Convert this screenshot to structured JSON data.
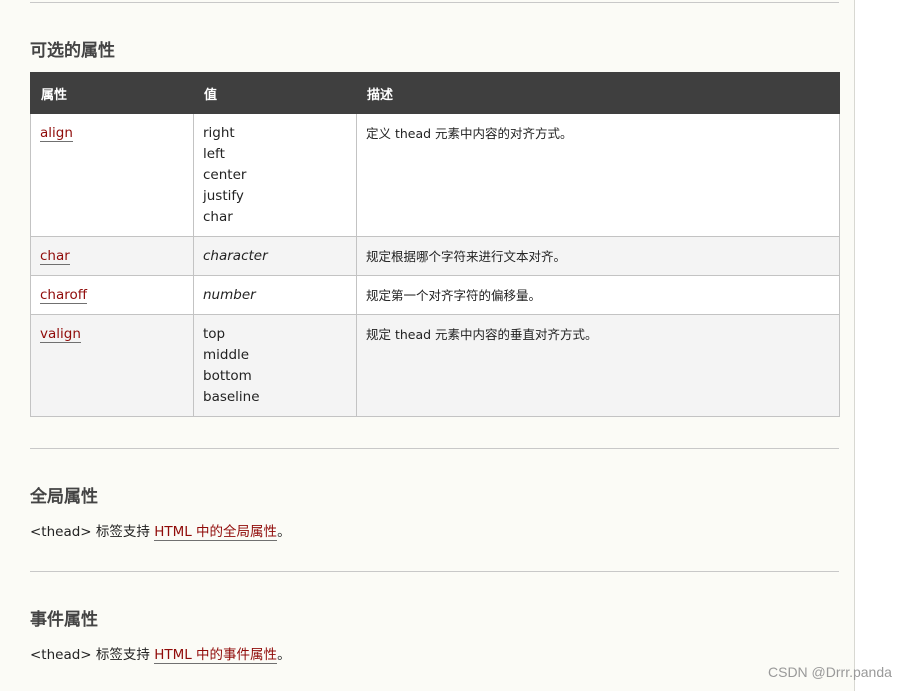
{
  "section_optional": {
    "title": "可选的属性",
    "headers": [
      "属性",
      "值",
      "描述"
    ],
    "rows": [
      {
        "attr": "align",
        "values": [
          "right",
          "left",
          "center",
          "justify",
          "char"
        ],
        "desc": "定义 thead 元素中内容的对齐方式。"
      },
      {
        "attr": "char",
        "values": [
          "character"
        ],
        "desc": "规定根据哪个字符来进行文本对齐。"
      },
      {
        "attr": "charoff",
        "values": [
          "number"
        ],
        "desc": "规定第一个对齐字符的偏移量。"
      },
      {
        "attr": "valign",
        "values": [
          "top",
          "middle",
          "bottom",
          "baseline"
        ],
        "desc": "规定 thead 元素中内容的垂直对齐方式。"
      }
    ]
  },
  "section_global": {
    "title": "全局属性",
    "text_prefix": "<thead> 标签支持 ",
    "link": "HTML 中的全局属性",
    "text_suffix": "。"
  },
  "section_event": {
    "title": "事件属性",
    "text_prefix": "<thead> 标签支持 ",
    "link": "HTML 中的事件属性",
    "text_suffix": "。"
  },
  "watermark": "CSDN @Drrr.panda"
}
